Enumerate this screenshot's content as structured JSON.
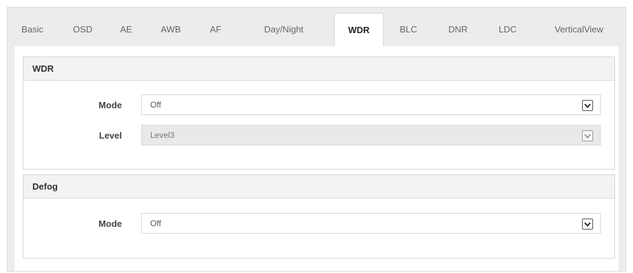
{
  "tabs": [
    {
      "label": "Basic",
      "active": false
    },
    {
      "label": "OSD",
      "active": false
    },
    {
      "label": "AE",
      "active": false
    },
    {
      "label": "AWB",
      "active": false
    },
    {
      "label": "AF",
      "active": false
    },
    {
      "label": "Day/Night",
      "active": false
    },
    {
      "label": "WDR",
      "active": true
    },
    {
      "label": "BLC",
      "active": false
    },
    {
      "label": "DNR",
      "active": false
    },
    {
      "label": "LDC",
      "active": false
    },
    {
      "label": "VerticalView",
      "active": false
    }
  ],
  "wdr": {
    "title": "WDR",
    "mode_label": "Mode",
    "mode_value": "Off",
    "level_label": "Level",
    "level_value": "Level3"
  },
  "defog": {
    "title": "Defog",
    "mode_label": "Mode",
    "mode_value": "Off"
  },
  "icons": {
    "dropdown": "chevron-down-icon"
  }
}
